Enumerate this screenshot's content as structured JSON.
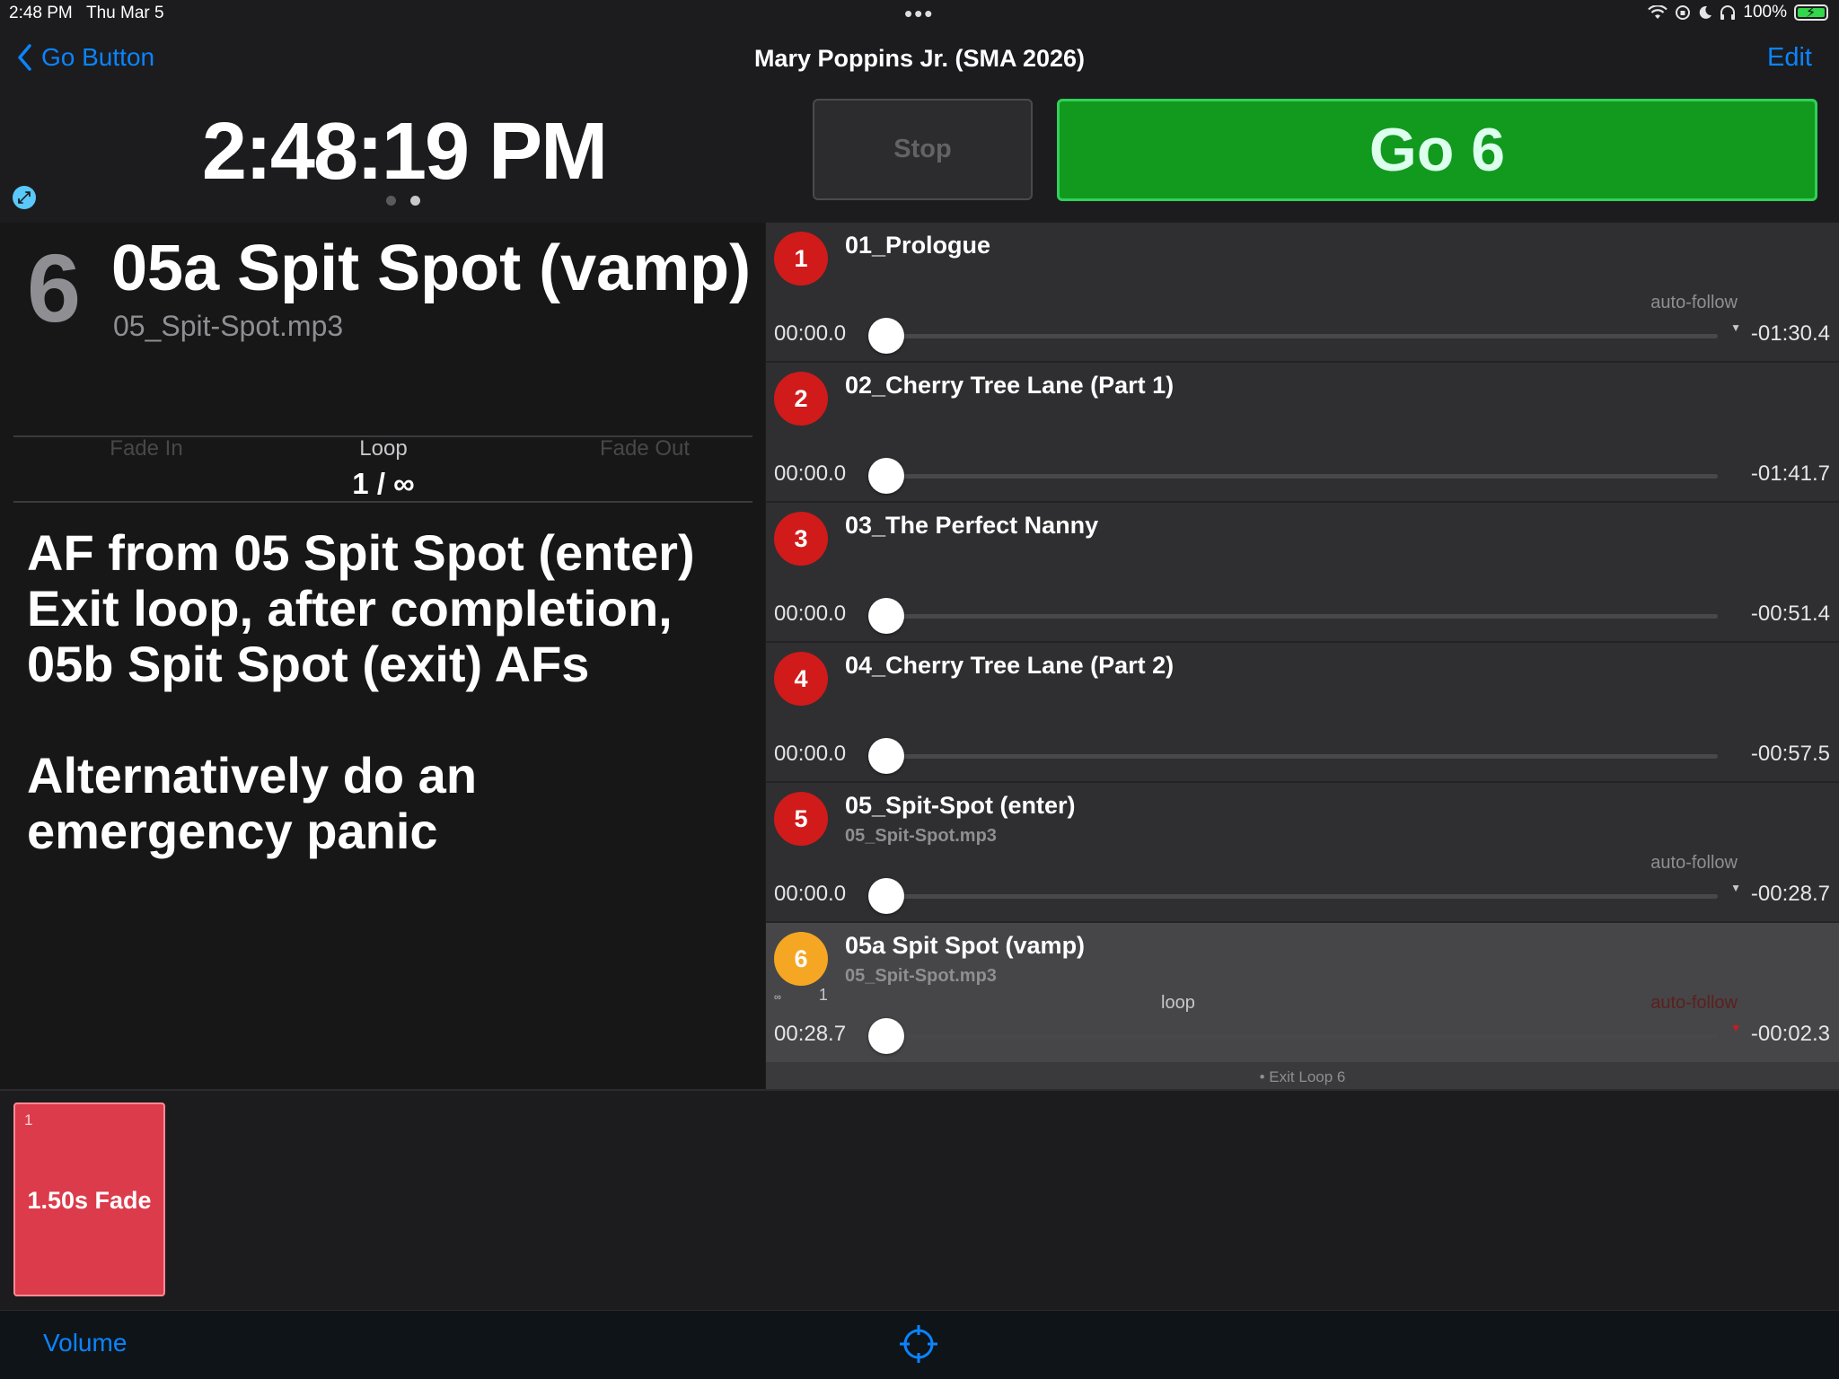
{
  "status_bar": {
    "time": "2:48 PM",
    "date": "Thu Mar 5",
    "dots": "•••",
    "battery": "100%"
  },
  "nav": {
    "back_label": "Go Button",
    "title": "Mary Poppins Jr. (SMA 2026)",
    "edit_label": "Edit"
  },
  "clock": "2:48:19 PM",
  "controls": {
    "stop_label": "Stop",
    "go_label": "Go 6",
    "go_color": "#119a1e"
  },
  "current_cue": {
    "number": "6",
    "name": "05a Spit Spot (vamp)",
    "file": "05_Spit-Spot.mp3",
    "fade_in_label": "Fade In",
    "loop_label": "Loop",
    "loop_value": "1 / ∞",
    "fade_out_label": "Fade Out",
    "notes": "AF from 05 Spit Spot (enter)\nExit loop, after completion, 05b Spit Spot (exit) AFs\n\nAlternatively do an emergency panic"
  },
  "cues": [
    {
      "number": "1",
      "name": "01_Prologue",
      "file": "",
      "elapsed": "00:00.0",
      "remaining": "-01:30.4",
      "auto_follow": "auto-follow",
      "progress": 0.0
    },
    {
      "number": "2",
      "name": "02_Cherry Tree Lane (Part 1)",
      "file": "",
      "elapsed": "00:00.0",
      "remaining": "-01:41.7",
      "auto_follow": "",
      "progress": 0.0
    },
    {
      "number": "3",
      "name": "03_The Perfect Nanny",
      "file": "",
      "elapsed": "00:00.0",
      "remaining": "-00:51.4",
      "auto_follow": "",
      "progress": 0.0
    },
    {
      "number": "4",
      "name": "04_Cherry Tree Lane (Part 2)",
      "file": "",
      "elapsed": "00:00.0",
      "remaining": "-00:57.5",
      "auto_follow": "",
      "progress": 0.0
    },
    {
      "number": "5",
      "name": "05_Spit-Spot (enter)",
      "file": "05_Spit-Spot.mp3",
      "elapsed": "00:00.0",
      "remaining": "-00:28.7",
      "auto_follow": "auto-follow",
      "progress": 0.0
    },
    {
      "number": "6",
      "name": "05a Spit Spot (vamp)",
      "file": "05_Spit-Spot.mp3",
      "elapsed": "00:28.7",
      "remaining": "-00:02.3",
      "auto_follow": "auto-follow",
      "loop": "loop",
      "loop_symbol": "∞",
      "loop_count": "1",
      "progress": 0.0
    }
  ],
  "exit_loop_label": "• Exit Loop 6",
  "fade_tile": {
    "number": "1",
    "label": "1.50s Fade",
    "color": "#dc3b4b"
  },
  "toolbar": {
    "volume_label": "Volume"
  },
  "icons": {
    "back": "chevron-left-icon",
    "expand": "expand-arrows-icon",
    "crosshair": "crosshair-icon"
  }
}
